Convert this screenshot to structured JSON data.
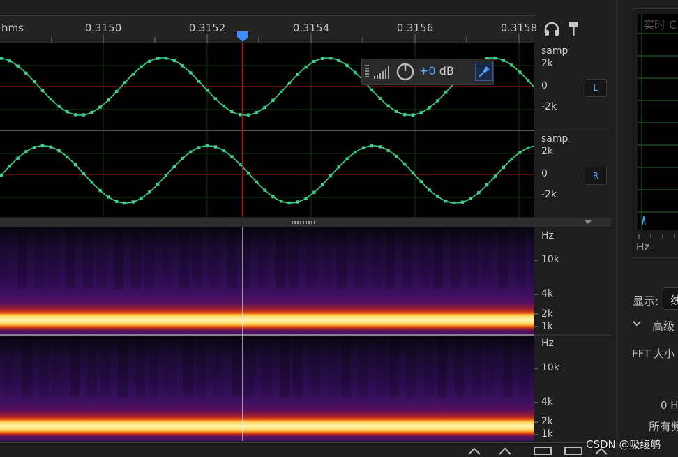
{
  "ruler": {
    "unit_label": "hms",
    "ticks": [
      "0.3150",
      "0.3152",
      "0.3154",
      "0.3156",
      "0.3158"
    ]
  },
  "waveform": {
    "channel_left": {
      "unit": "samp",
      "scale_labels": [
        "2k",
        "0",
        "-2k"
      ],
      "button": "L"
    },
    "channel_right": {
      "unit": "samp",
      "scale_labels": [
        "2k",
        "0",
        "-2k"
      ],
      "button": "R"
    },
    "wave_color": "#3fd08a",
    "playhead_color": "#e02020"
  },
  "hud": {
    "gain_value": "+0",
    "gain_unit": "dB"
  },
  "spectral": {
    "top_labels": [
      "Hz",
      "10k",
      "4k",
      "2k",
      "1k"
    ],
    "bottom_labels": [
      "Hz",
      "10k",
      "4k",
      "2k",
      "1k"
    ]
  },
  "side_panel": {
    "realtime_title": "实时 C",
    "hz_label": "Hz",
    "display_label": "显示:",
    "display_value": "线",
    "advanced_label": "高级",
    "fft_label": "FFT 大小",
    "zero_hz_label": "0 H",
    "all_label": "所有频"
  },
  "watermark": "CSDN @吸绫鸲"
}
